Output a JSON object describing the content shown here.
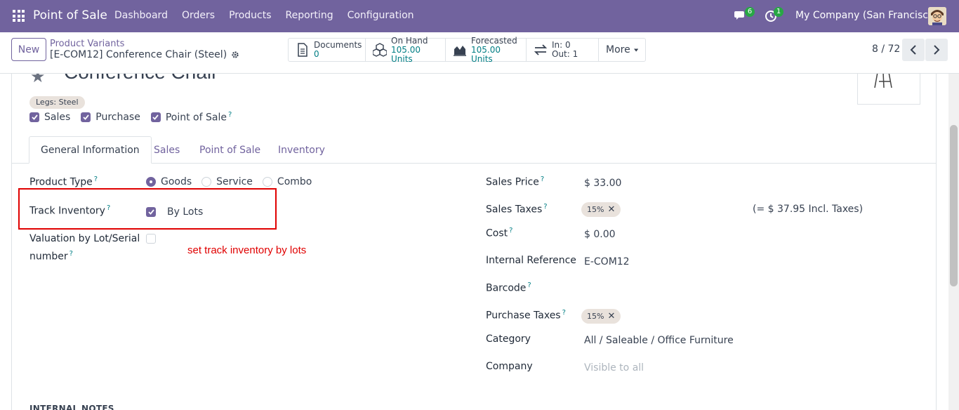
{
  "navbar": {
    "app_name": "Point of Sale",
    "menu": [
      "Dashboard",
      "Orders",
      "Products",
      "Reporting",
      "Configuration"
    ],
    "chat_badge": "6",
    "activity_badge": "1",
    "company": "My Company (San Francisco)"
  },
  "control": {
    "new_label": "New",
    "breadcrumb": "Product Variants",
    "record_name": "[E-COM12] Conference Chair (Steel)",
    "stats": {
      "documents_label": "Documents",
      "documents_value": "0",
      "on_hand_label": "On Hand",
      "on_hand_value": "105.00 Units",
      "forecasted_label": "Forecasted",
      "forecasted_value": "105.00 Units",
      "in_label": "In: 0",
      "out_label": "Out: 1",
      "more_label": "More"
    },
    "pager": "8 / 72"
  },
  "form": {
    "title": "Conference Chair",
    "variant_tag": "Legs: Steel",
    "flags": [
      {
        "label": "Sales",
        "checked": true
      },
      {
        "label": "Purchase",
        "checked": true
      },
      {
        "label": "Point of Sale",
        "checked": true,
        "help": "?"
      }
    ],
    "tabs": [
      "General Information",
      "Sales",
      "Point of Sale",
      "Inventory"
    ],
    "left": {
      "product_type_label": "Product Type",
      "product_type_options": [
        "Goods",
        "Service",
        "Combo"
      ],
      "track_inventory_label": "Track Inventory",
      "track_inventory_value": "By Lots",
      "valuation_label_1": "Valuation by Lot/Serial",
      "valuation_label_2": "number"
    },
    "right": {
      "sales_price_label": "Sales Price",
      "sales_price_value": "$ 33.00",
      "sales_taxes_label": "Sales Taxes",
      "sales_taxes_tag": "15%",
      "sales_taxes_incl": "(= $ 37.95 Incl. Taxes)",
      "cost_label": "Cost",
      "cost_value": "$ 0.00",
      "internal_ref_label": "Internal Reference",
      "internal_ref_value": "E-COM12",
      "barcode_label": "Barcode",
      "purchase_taxes_label": "Purchase Taxes",
      "purchase_taxes_tag": "15%",
      "category_label": "Category",
      "category_value": "All / Saleable / Office Furniture",
      "company_label": "Company",
      "company_placeholder": "Visible to all"
    },
    "notes_heading": "INTERNAL NOTES",
    "annotation": "set track inventory by lots",
    "help_mark": "?"
  },
  "colors": {
    "navbar": "#71639e",
    "accent": "#71639e",
    "annotation": "#e00000",
    "badge": "#28a745"
  }
}
